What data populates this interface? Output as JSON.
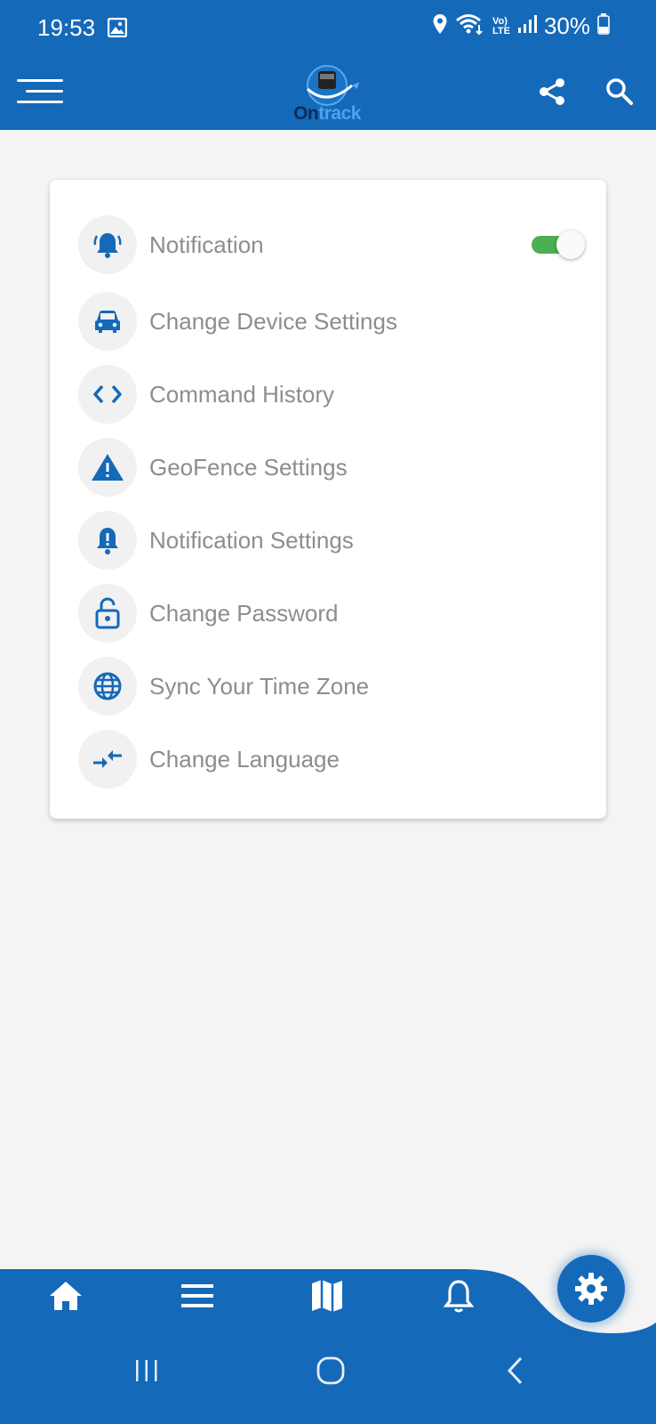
{
  "status_bar": {
    "time": "19:53",
    "signal_label_top": "Vo)",
    "signal_label_bottom": "LTE",
    "battery": "30%"
  },
  "app_bar": {
    "logo_text_on": "On",
    "logo_text_track": "track"
  },
  "settings": {
    "items": [
      {
        "label": "Notification",
        "icon": "bell-ringing-icon",
        "toggle_on": true
      },
      {
        "label": "Change Device Settings",
        "icon": "car-icon"
      },
      {
        "label": "Command History",
        "icon": "code-icon"
      },
      {
        "label": "GeoFence Settings",
        "icon": "warning-triangle-icon"
      },
      {
        "label": "Notification Settings",
        "icon": "bell-alert-icon"
      },
      {
        "label": "Change Password",
        "icon": "lock-open-icon"
      },
      {
        "label": "Sync Your Time Zone",
        "icon": "globe-icon"
      },
      {
        "label": "Change Language",
        "icon": "swap-arrows-icon"
      }
    ]
  },
  "colors": {
    "brand": "#1469b9",
    "toggle_on": "#4caf50",
    "label_gray": "#8d8d8d"
  },
  "bottom_nav": {
    "items": [
      "home-icon",
      "list-icon",
      "map-icon",
      "bell-icon"
    ],
    "fab": "settings-gear-icon"
  }
}
